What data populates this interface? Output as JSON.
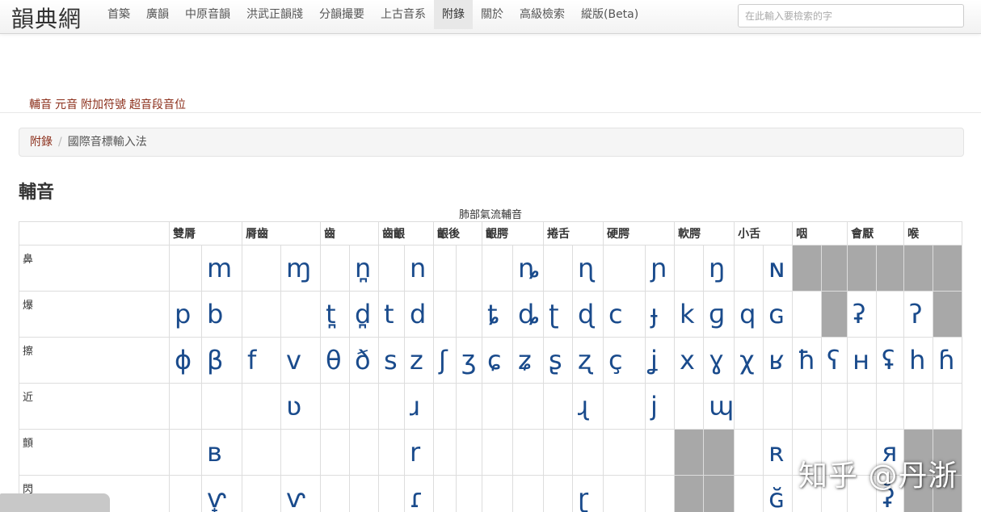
{
  "brand": "韻典網",
  "nav": [
    "首築",
    "廣韻",
    "中原音韻",
    "洪武正韻牋",
    "分韻撮要",
    "上古音系",
    "附錄",
    "關於",
    "高級檢索",
    "縱版(Beta)"
  ],
  "search": {
    "placeholder": "在此輸入要檢索的字"
  },
  "sublinks": [
    "輔音",
    "元音",
    "附加符號",
    "超音段音位"
  ],
  "breadcrumb": {
    "link": "附錄",
    "separator": "/",
    "current": "國際音標輸入法"
  },
  "section_title": "輔音",
  "table": {
    "caption": "肺部氣流輔音",
    "columns": [
      {
        "label": "",
        "span": 1
      },
      {
        "label": "雙脣",
        "span": 2
      },
      {
        "label": "脣齒",
        "span": 2
      },
      {
        "label": "齒",
        "span": 2
      },
      {
        "label": "齒齦",
        "span": 2
      },
      {
        "label": "齦後",
        "span": 2
      },
      {
        "label": "齦腭",
        "span": 2
      },
      {
        "label": "捲舌",
        "span": 2
      },
      {
        "label": "硬腭",
        "span": 2
      },
      {
        "label": "軟腭",
        "span": 2
      },
      {
        "label": "小舌",
        "span": 2
      },
      {
        "label": "咽",
        "span": 2
      },
      {
        "label": "會厭",
        "span": 2
      },
      {
        "label": "喉",
        "span": 2
      }
    ],
    "rows": [
      {
        "label": "鼻",
        "cells": [
          "",
          "m",
          "",
          "ɱ",
          "",
          "n̪",
          "",
          "n",
          "",
          "",
          "",
          "ȵ",
          "",
          "ɳ",
          "",
          "ɲ",
          "",
          "ŋ",
          "",
          "ɴ",
          "#",
          "#",
          "#",
          "#",
          "#",
          "#"
        ]
      },
      {
        "label": "爆",
        "cells": [
          "p",
          "b",
          "",
          "",
          "t̪",
          "d̪",
          "t",
          "d",
          "",
          "",
          "ȶ",
          "ȡ",
          "ʈ",
          "ɖ",
          "c",
          "ɟ",
          "k",
          "ɡ",
          "q",
          "ɢ",
          "",
          "#",
          "ʡ",
          "",
          "ʔ",
          "#"
        ]
      },
      {
        "label": "擦",
        "cells": [
          "ɸ",
          "β",
          "f",
          "v",
          "θ",
          "ð",
          "s",
          "z",
          "ʃ",
          "ʒ",
          "ɕ",
          "ʑ",
          "ʂ",
          "ʐ",
          "ç",
          "ʝ",
          "x",
          "ɣ",
          "χ",
          "ʁ",
          "ħ",
          "ʕ",
          "ʜ",
          "ʢ",
          "h",
          "ɦ"
        ]
      },
      {
        "label": "近",
        "cells": [
          "",
          "",
          "",
          "ʋ",
          "",
          "",
          "",
          "ɹ",
          "",
          "",
          "",
          "",
          "",
          "ɻ",
          "",
          "j",
          "",
          "ɰ",
          "",
          "",
          "",
          "",
          "",
          "",
          "",
          ""
        ]
      },
      {
        "label": "顫",
        "cells": [
          "",
          "ʙ",
          "",
          "",
          "",
          "",
          "",
          "r",
          "",
          "",
          "",
          "",
          "",
          "",
          "",
          "",
          "#",
          "#",
          "",
          "ʀ",
          "",
          "",
          "",
          "я",
          "#",
          "#"
        ]
      },
      {
        "label": "閃",
        "cells": [
          "",
          "ⱱ̟",
          "",
          "ⱱ",
          "",
          "",
          "",
          "ɾ",
          "",
          "",
          "",
          "",
          "",
          "ɽ",
          "",
          "",
          "#",
          "#",
          "",
          "ɢ̆",
          "",
          "",
          "",
          "ʡ̆",
          "#",
          "#"
        ]
      }
    ]
  },
  "watermark": "知乎 @丹浙"
}
